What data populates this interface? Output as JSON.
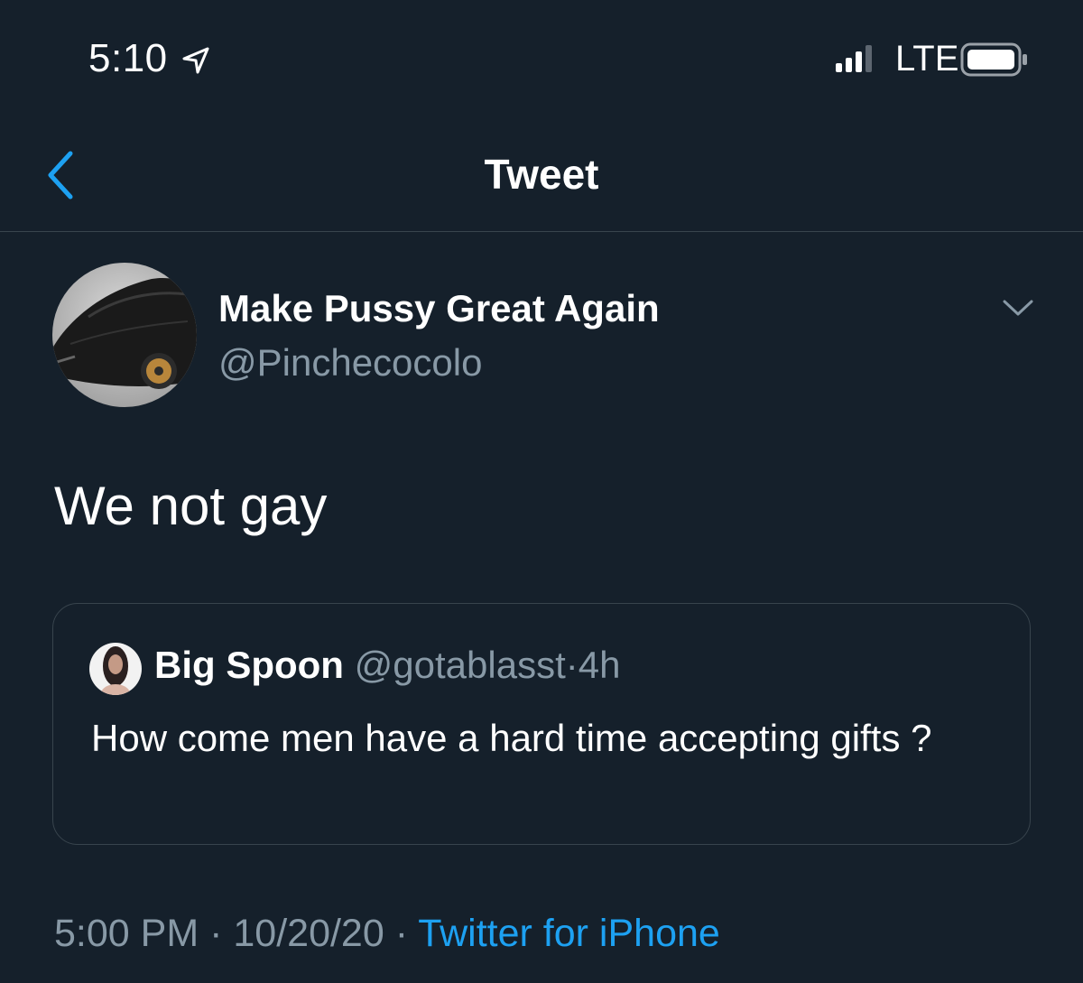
{
  "status_bar": {
    "time": "5:10",
    "network": "LTE",
    "icons": [
      "location-arrow-icon",
      "signal-bars-icon",
      "battery-icon"
    ]
  },
  "nav": {
    "title": "Tweet",
    "back_icon": "chevron-left-icon"
  },
  "tweet": {
    "display_name": "Make Pussy Great Again",
    "handle": "@Pinchecocolo",
    "text": "We not gay",
    "timestamp_time": "5:00 PM",
    "separator": "·",
    "timestamp_date": "10/20/20",
    "source": "Twitter for iPhone"
  },
  "quoted_tweet": {
    "display_name": "Big Spoon",
    "handle": "@gotablasst",
    "separator": "·",
    "age": "4h",
    "text": "How come men have a hard time accepting gifts ?"
  },
  "colors": {
    "background": "#15202b",
    "divider": "#38444d",
    "secondary_text": "#8899a6",
    "accent": "#1da1f2",
    "primary_text": "#ffffff"
  }
}
